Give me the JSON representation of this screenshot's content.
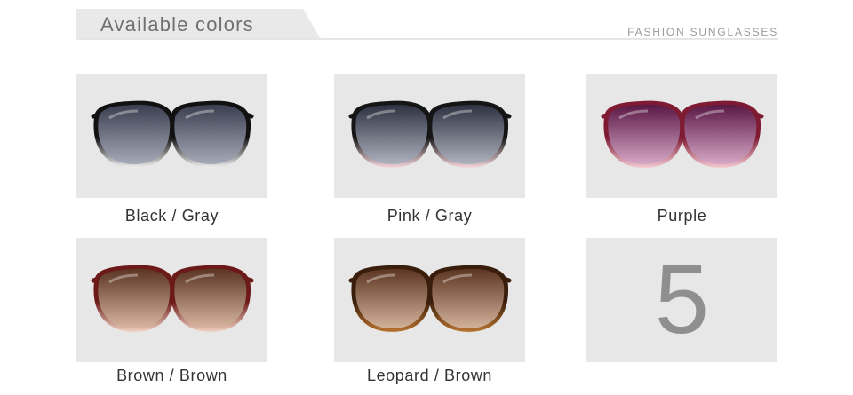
{
  "header": {
    "title": "Available colors",
    "subtitle": "FASHION SUNGLASSES"
  },
  "products": [
    {
      "label": "Black / Gray",
      "icon": "sunglasses-black-gray-icon",
      "frame": "#111111",
      "frame_fade": "#f0f0f0",
      "lens_top": "#3a3e4f",
      "lens_bottom": "#a6aab8"
    },
    {
      "label": "Pink / Gray",
      "icon": "sunglasses-pink-gray-icon",
      "frame": "#151515",
      "frame_fade": "#f6d6dc",
      "lens_top": "#2e3140",
      "lens_bottom": "#aeb2be"
    },
    {
      "label": "Purple",
      "icon": "sunglasses-purple-icon",
      "frame": "#7e1b33",
      "frame_fade": "#f4c9d2",
      "lens_top": "#5a1845",
      "lens_bottom": "#d6a7c6"
    },
    {
      "label": "Brown / Brown",
      "icon": "sunglasses-brown-brown-icon",
      "frame": "#6c1a19",
      "frame_fade": "#f2d2c2",
      "lens_top": "#5b3423",
      "lens_bottom": "#d8b7a0"
    },
    {
      "label": "Leopard / Brown",
      "icon": "sunglasses-leopard-brown-icon",
      "frame": "#3a1e0c",
      "frame_fade": "#b8742f",
      "lens_top": "#5c3522",
      "lens_bottom": "#d3b29a"
    }
  ],
  "count_tile": {
    "number": "5"
  }
}
